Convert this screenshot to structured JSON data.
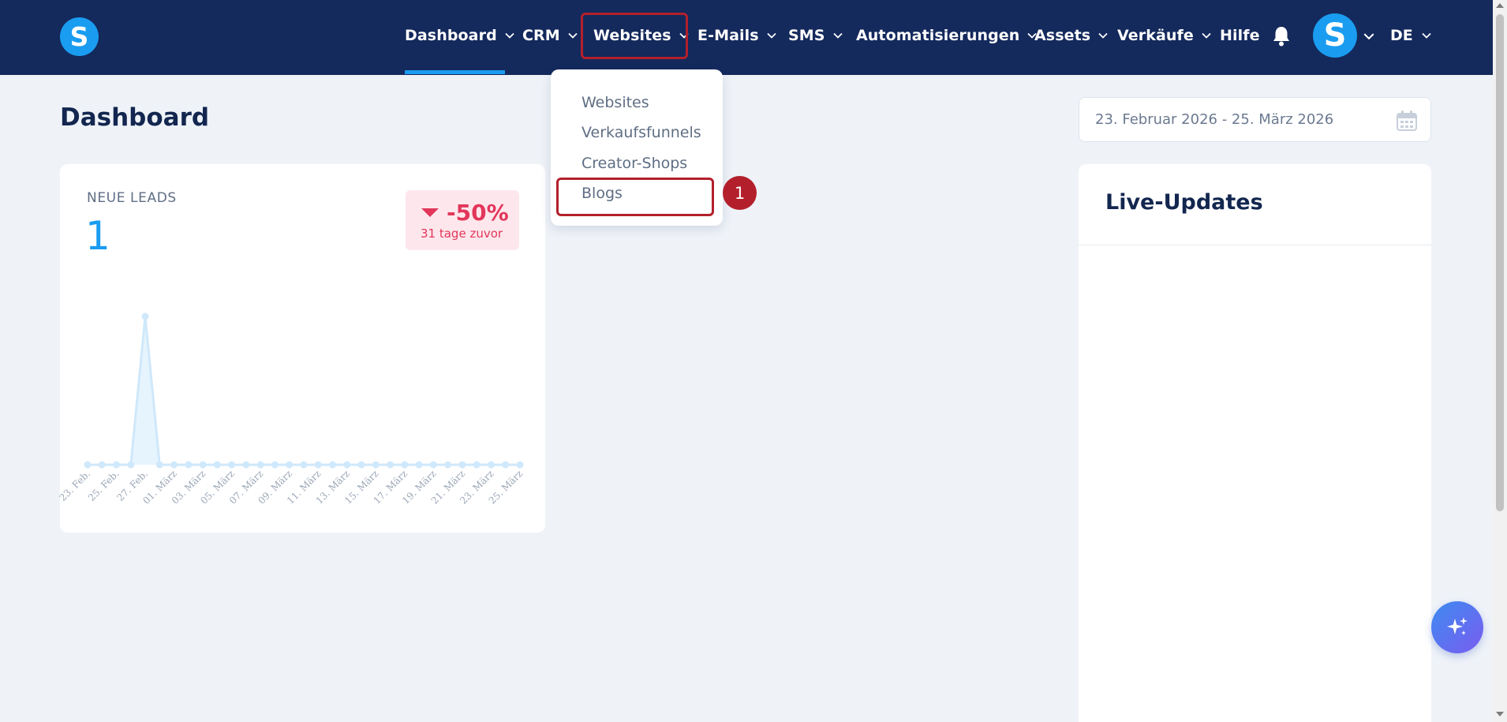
{
  "nav": {
    "logo_letter": "S",
    "items": [
      {
        "label": "Dashboard",
        "has_chevron": true
      },
      {
        "label": "CRM",
        "has_chevron": true
      },
      {
        "label": "Websites",
        "has_chevron": true
      },
      {
        "label": "E-Mails",
        "has_chevron": true
      },
      {
        "label": "SMS",
        "has_chevron": true
      },
      {
        "label": "Automatisierungen",
        "has_chevron": true
      },
      {
        "label": "Assets",
        "has_chevron": true
      },
      {
        "label": "Verkäufe",
        "has_chevron": true
      },
      {
        "label": "Hilfe",
        "has_chevron": false
      }
    ],
    "active_item": "Dashboard",
    "highlighted_item": "Websites",
    "avatar_letter": "S",
    "language": "DE",
    "icons": [
      "bell-icon",
      "chevron-down-icon"
    ]
  },
  "dropdown": {
    "items": [
      {
        "label": "Websites"
      },
      {
        "label": "Verkaufsfunnels"
      },
      {
        "label": "Creator-Shops"
      },
      {
        "label": "Blogs"
      }
    ],
    "highlighted_item": "Blogs",
    "step_number": "1"
  },
  "page": {
    "title": "Dashboard",
    "date_range": "23. Februar 2026 - 25. März 2026",
    "date_icon": "calendar-icon"
  },
  "leads": {
    "label": "NEUE LEADS",
    "value": "1",
    "trend_value": "-50%",
    "trend_note": "31 tage zuvor",
    "trend_direction": "down"
  },
  "chart_data": {
    "type": "area",
    "title": "",
    "x": [
      "23. Feb.",
      "24. Feb.",
      "25. Feb.",
      "26. Feb.",
      "27. Feb.",
      "28. Feb.",
      "01. März",
      "02. März",
      "03. März",
      "04. März",
      "05. März",
      "06. März",
      "07. März",
      "08. März",
      "09. März",
      "10. März",
      "11. März",
      "12. März",
      "13. März",
      "14. März",
      "15. März",
      "16. März",
      "17. März",
      "18. März",
      "19. März",
      "20. März",
      "21. März",
      "22. März",
      "23. März",
      "24. März",
      "25. März"
    ],
    "tick_labels": [
      "23. Feb.",
      "25. Feb.",
      "27. Feb.",
      "01. März",
      "03. März",
      "05. März",
      "07. März",
      "09. März",
      "11. März",
      "13. März",
      "15. März",
      "17. März",
      "19. März",
      "21. März",
      "23. März",
      "25. März"
    ],
    "series": [
      {
        "values": [
          0,
          0,
          0,
          0,
          1,
          0,
          0,
          0,
          0,
          0,
          0,
          0,
          0,
          0,
          0,
          0,
          0,
          0,
          0,
          0,
          0,
          0,
          0,
          0,
          0,
          0,
          0,
          0,
          0,
          0,
          0
        ]
      }
    ],
    "ylim": [
      0,
      1
    ],
    "grid": false,
    "legend": "none",
    "colors": {
      "line": "#cfe8fb",
      "fill": "#e6f4fe",
      "point": "#cfe8fb"
    }
  },
  "live_updates": {
    "title": "Live-Updates"
  },
  "fab": {
    "icon": "sparkles-icon"
  },
  "colors": {
    "nav_bg": "#14295c",
    "accent": "#1a9cf0",
    "highlight": "#b3202b",
    "negative": "#e2365a",
    "page_bg": "#eff3f8"
  }
}
